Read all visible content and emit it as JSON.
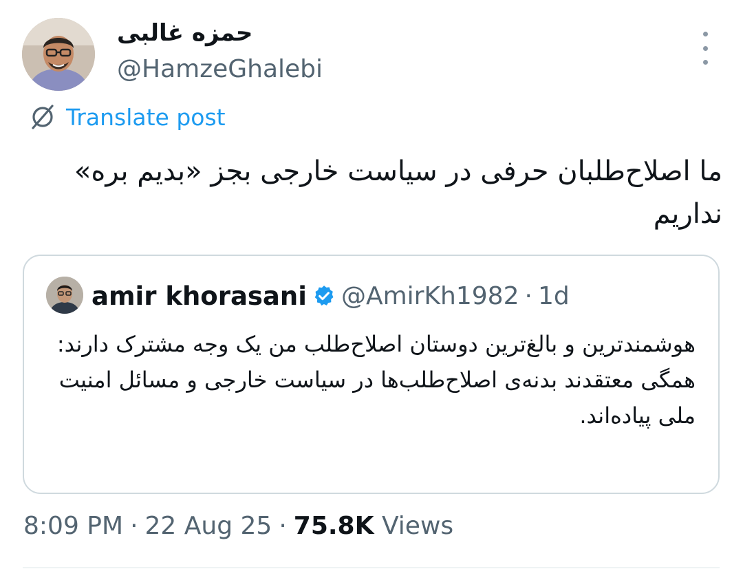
{
  "tweet": {
    "author": {
      "display_name": "حمزه غالبی",
      "handle": "@HamzeGhalebi",
      "avatar_icon": "person-avatar"
    },
    "translate_label": "Translate post",
    "text": "ما اصلاح‌طلبان حرفی در سیاست خارجی بجز «بدیم بره» نداریم",
    "more_icon": "more-vertical-icon"
  },
  "quote": {
    "name": "amir khorasani",
    "verified": true,
    "handle": "@AmirKh1982",
    "separator": "·",
    "time": "1d",
    "paragraph1": "هوشمندترین و بالغ‌ترین دوستان اصلاح‌طلب من یک وجه مشترک دارند:",
    "paragraph2": "همگی معتقدند بدنه‌ی اصلاح‌طلب‌ها در سیاست خارجی و مسائل امنیت ملی پیاده‌اند."
  },
  "meta": {
    "time": "8:09 PM",
    "sep1": "·",
    "date": "22 Aug 25",
    "sep2": "·",
    "views_count": "75.8K",
    "views_label": "Views"
  },
  "colors": {
    "link": "#1d9bf0",
    "secondary": "#536471",
    "verified": "#1d9bf0"
  }
}
